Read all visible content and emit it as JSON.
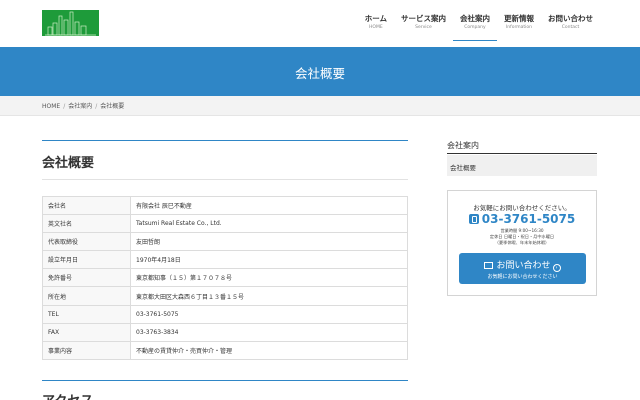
{
  "nav": [
    {
      "ja": "ホーム",
      "en": "HOME"
    },
    {
      "ja": "サービス案内",
      "en": "Service"
    },
    {
      "ja": "会社案内",
      "en": "Company"
    },
    {
      "ja": "更新情報",
      "en": "Information"
    },
    {
      "ja": "お問い合わせ",
      "en": "Contact"
    }
  ],
  "banner": {
    "title": "会社概要"
  },
  "breadcrumb": {
    "home": "HOME",
    "parent": "会社案内",
    "current": "会社概要",
    "sep": "/"
  },
  "main": {
    "title": "会社概要",
    "rows": [
      {
        "k": "会社名",
        "v": "有限会社 辰巳不動産"
      },
      {
        "k": "英文社名",
        "v": "Tatsumi Real Estate Co., Ltd."
      },
      {
        "k": "代表取締役",
        "v": "友田哲朗"
      },
      {
        "k": "設立年月日",
        "v": "1970年4月18日"
      },
      {
        "k": "免許番号",
        "v": "東京都知事（１５）第１７０７８号"
      },
      {
        "k": "所在地",
        "v": "東京都大田区大森西６丁目１３番１５号"
      },
      {
        "k": "TEL",
        "v": "03-3761-5075"
      },
      {
        "k": "FAX",
        "v": "03-3763-3834"
      },
      {
        "k": "事業内容",
        "v": "不動産の賃貸仲介・売買仲介・管理"
      }
    ],
    "access_title": "アクセス"
  },
  "sidebar": {
    "title": "会社案内",
    "link": "会社概要",
    "contact": {
      "lead": "お気軽にお問い合わせください。",
      "tel": "03-3761-5075",
      "hours1": "営業時間 9:00~16:30",
      "hours2": "定休日 日曜日・祝日・月中水曜日",
      "hours3": "（夏季休暇、年末年始休暇）",
      "button_main": "お問い合わせ",
      "button_sub": "お気軽にお問い合わせください"
    }
  },
  "colors": {
    "brand": "#2f86c6",
    "logo": "#1e9b3a"
  }
}
